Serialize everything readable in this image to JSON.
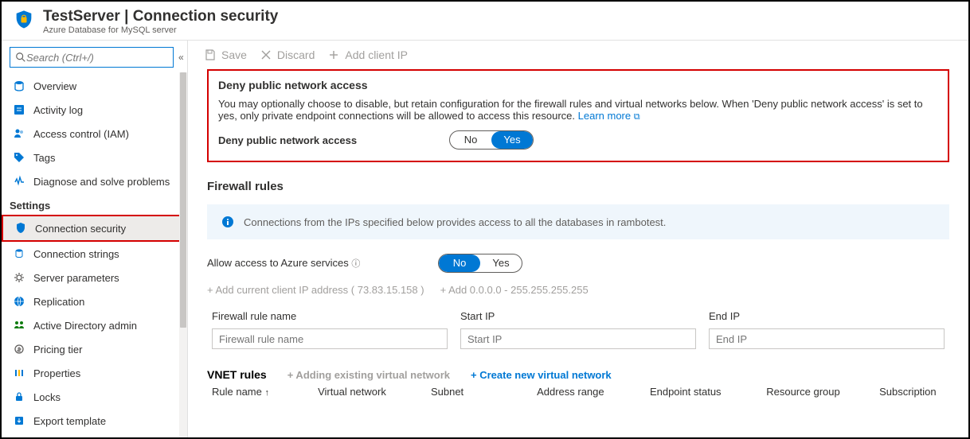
{
  "header": {
    "title": "TestServer | Connection security",
    "subtitle": "Azure Database for MySQL server"
  },
  "search": {
    "placeholder": "Search (Ctrl+/)"
  },
  "nav": {
    "overview": "Overview",
    "activity": "Activity log",
    "iam": "Access control (IAM)",
    "tags": "Tags",
    "diag": "Diagnose and solve problems",
    "group_settings": "Settings",
    "conn_sec": "Connection security",
    "conn_str": "Connection strings",
    "server_params": "Server parameters",
    "replication": "Replication",
    "aad": "Active Directory admin",
    "pricing": "Pricing tier",
    "properties": "Properties",
    "locks": "Locks",
    "export": "Export template"
  },
  "toolbar": {
    "save": "Save",
    "discard": "Discard",
    "addip": "Add client IP"
  },
  "deny": {
    "title": "Deny public network access",
    "desc": "You may optionally choose to disable, but retain configuration for the firewall rules and virtual networks below. When 'Deny public network access' is set to yes, only private endpoint connections will be allowed to access this resource. ",
    "learn": "Learn more",
    "label": "Deny public network access",
    "no": "No",
    "yes": "Yes"
  },
  "firewall": {
    "title": "Firewall rules",
    "info": "Connections from the IPs specified below provides access to all the databases in rambotest.",
    "allow_label": "Allow access to Azure services",
    "no": "No",
    "yes": "Yes",
    "add_current": "+ Add current client IP address ( 73.83.15.158 )",
    "add_range": "+ Add 0.0.0.0 - 255.255.255.255",
    "col_rule": "Firewall rule name",
    "col_start": "Start IP",
    "col_end": "End IP",
    "ph_rule": "Firewall rule name",
    "ph_start": "Start IP",
    "ph_end": "End IP"
  },
  "vnet": {
    "title": "VNET rules",
    "add_existing": "+ Adding existing virtual network",
    "create_new": "+ Create new virtual network",
    "c1": "Rule name",
    "c2": "Virtual network",
    "c3": "Subnet",
    "c4": "Address range",
    "c5": "Endpoint status",
    "c6": "Resource group",
    "c7": "Subscription"
  }
}
